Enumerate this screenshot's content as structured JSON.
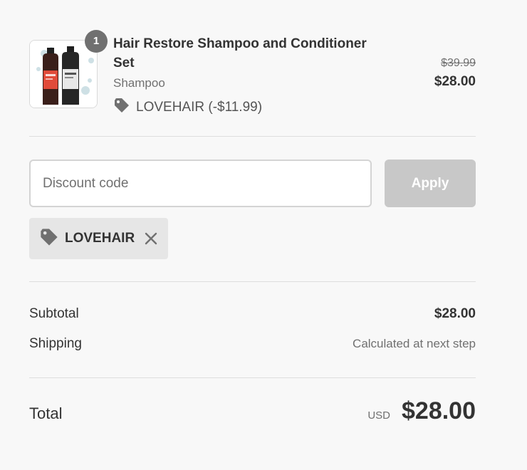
{
  "product": {
    "quantity": "1",
    "title": "Hair Restore Shampoo and Conditioner Set",
    "variant": "Shampoo",
    "discount": "LOVEHAIR (-$11.99)",
    "original_price": "$39.99",
    "price": "$28.00"
  },
  "discount_form": {
    "placeholder": "Discount code",
    "apply_label": "Apply"
  },
  "applied_code": {
    "code": "LOVEHAIR"
  },
  "totals": {
    "subtotal_label": "Subtotal",
    "subtotal_value": "$28.00",
    "shipping_label": "Shipping",
    "shipping_value": "Calculated at next step",
    "total_label": "Total",
    "currency": "USD",
    "total_value": "$28.00"
  },
  "icons": {
    "tag": "tag-icon",
    "remove": "close-icon"
  },
  "colors": {
    "background": "#f8f8f8",
    "text": "#333333",
    "muted": "#707070",
    "apply_disabled": "#c8c8c8",
    "pill": "#e6e6e6",
    "bottle_label": "#e04b3a"
  }
}
